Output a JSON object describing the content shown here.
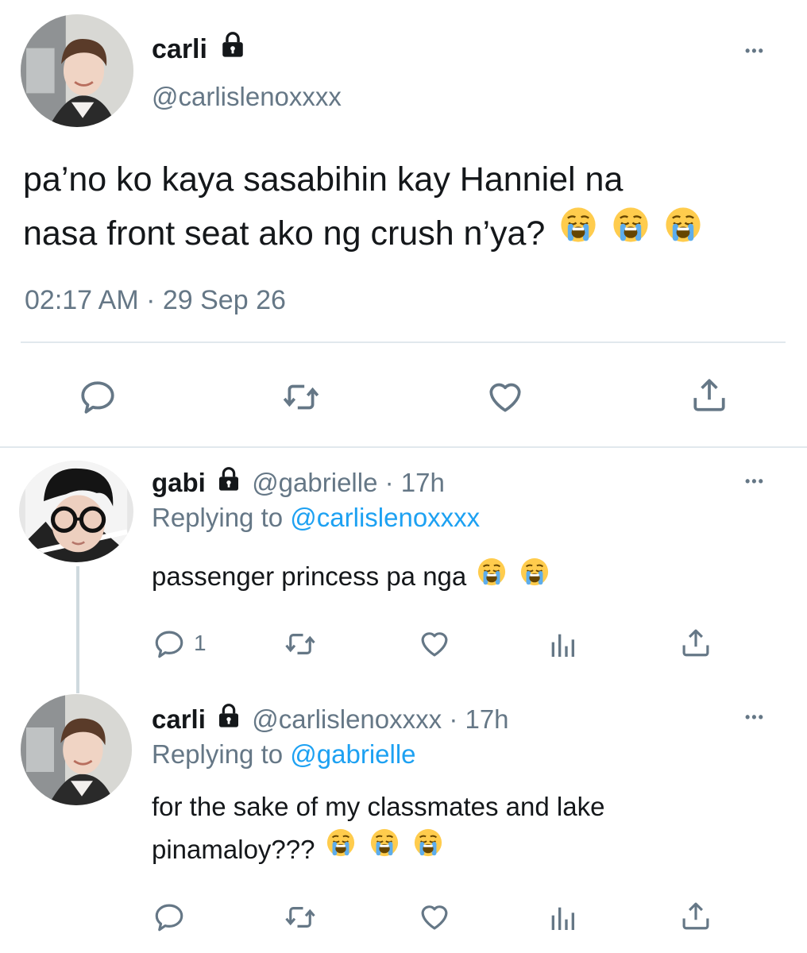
{
  "main_tweet": {
    "display_name": "carli",
    "handle": "@carlislenoxxxx",
    "text_line1": "pa’no ko kaya sasabihin kay Hanniel na",
    "text_line2": "nasa front seat ako ng crush n’ya?",
    "timestamp": "02:17 AM · 29 Sep 26",
    "more_label": "•••"
  },
  "reply1": {
    "display_name": "gabi",
    "handle": "@gabrielle",
    "time": "· 17h",
    "replying_prefix": "Replying to",
    "replying_to": "@carlislenoxxxx",
    "text": "passenger princess pa nga",
    "reply_count": "1",
    "more_label": "•••"
  },
  "reply2": {
    "display_name": "carli",
    "handle": "@carlislenoxxxx",
    "time": "· 17h",
    "replying_prefix": "Replying to",
    "replying_to": "@gabrielle",
    "text_line1": "for the sake of my classmates and lake",
    "text_line2": "pinamaloy???",
    "more_label": "•••"
  },
  "icons": {
    "reply": "reply-icon",
    "retweet": "retweet-icon",
    "like": "heart-icon",
    "share": "share-icon",
    "analytics": "analytics-icon",
    "lock": "lock-icon",
    "emoji": "loudly-crying-face-emoji"
  },
  "colors": {
    "text": "#14171a",
    "secondary": "#657786",
    "link": "#1da1f2",
    "divider": "#e1e8ed"
  }
}
